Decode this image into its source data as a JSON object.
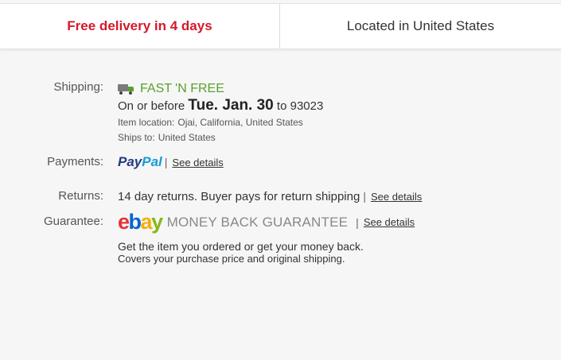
{
  "header": {
    "delivery": "Free delivery in 4 days",
    "location": "Located in United States"
  },
  "colors": {
    "delivery_red": "#d5192b",
    "fast_green": "#5aa02c"
  },
  "shipping": {
    "label": "Shipping:",
    "icon": "truck-icon",
    "service": "FAST 'N FREE",
    "prefix": "On or before",
    "date": "Tue. Jan. 30",
    "to_text": "to 93023",
    "item_location_label": "Item location:",
    "item_location": "Ojai, California, United States",
    "ships_to_label": "Ships to:",
    "ships_to": "United States"
  },
  "payments": {
    "label": "Payments:",
    "logo_part1": "Pay",
    "logo_part2": "Pal",
    "separator": "|",
    "link": "See details"
  },
  "returns": {
    "label": "Returns:",
    "text": "14 day returns. Buyer pays for return shipping",
    "separator": "|",
    "link": "See details"
  },
  "guarantee": {
    "label": "Guarantee:",
    "logo_e": "e",
    "logo_b": "b",
    "logo_a": "a",
    "logo_y": "y",
    "logo_tagline": "MONEY BACK GUARANTEE",
    "separator": "|",
    "link": "See details",
    "line1": "Get the item you ordered or get your money back.",
    "line2": "Covers your purchase price and original shipping."
  }
}
